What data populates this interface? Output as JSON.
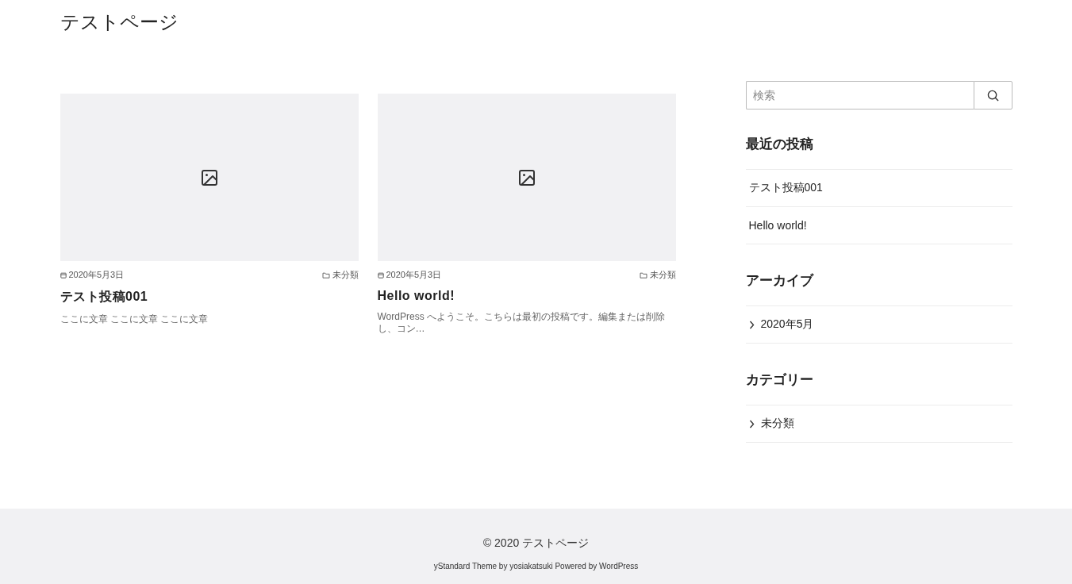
{
  "site_title": "テストページ",
  "posts": [
    {
      "date": "2020年5月3日",
      "category": "未分類",
      "title": "テスト投稿001",
      "excerpt": "ここに文章 ここに文章 ここに文章"
    },
    {
      "date": "2020年5月3日",
      "category": "未分類",
      "title": "Hello world!",
      "excerpt": "WordPress へようこそ。こちらは最初の投稿です。編集または削除し、コン…"
    }
  ],
  "search": {
    "placeholder": "検索"
  },
  "widgets": [
    {
      "title": "最近の投稿",
      "kind": "plain",
      "items": [
        "テスト投稿001",
        "Hello world!"
      ]
    },
    {
      "title": "アーカイブ",
      "kind": "arrow",
      "items": [
        "2020年5月"
      ]
    },
    {
      "title": "カテゴリー",
      "kind": "arrow",
      "items": [
        "未分類"
      ]
    }
  ],
  "footer": {
    "copyright": "© 2020 テストページ",
    "credit": "yStandard Theme by yosiakatsuki Powered by WordPress"
  }
}
